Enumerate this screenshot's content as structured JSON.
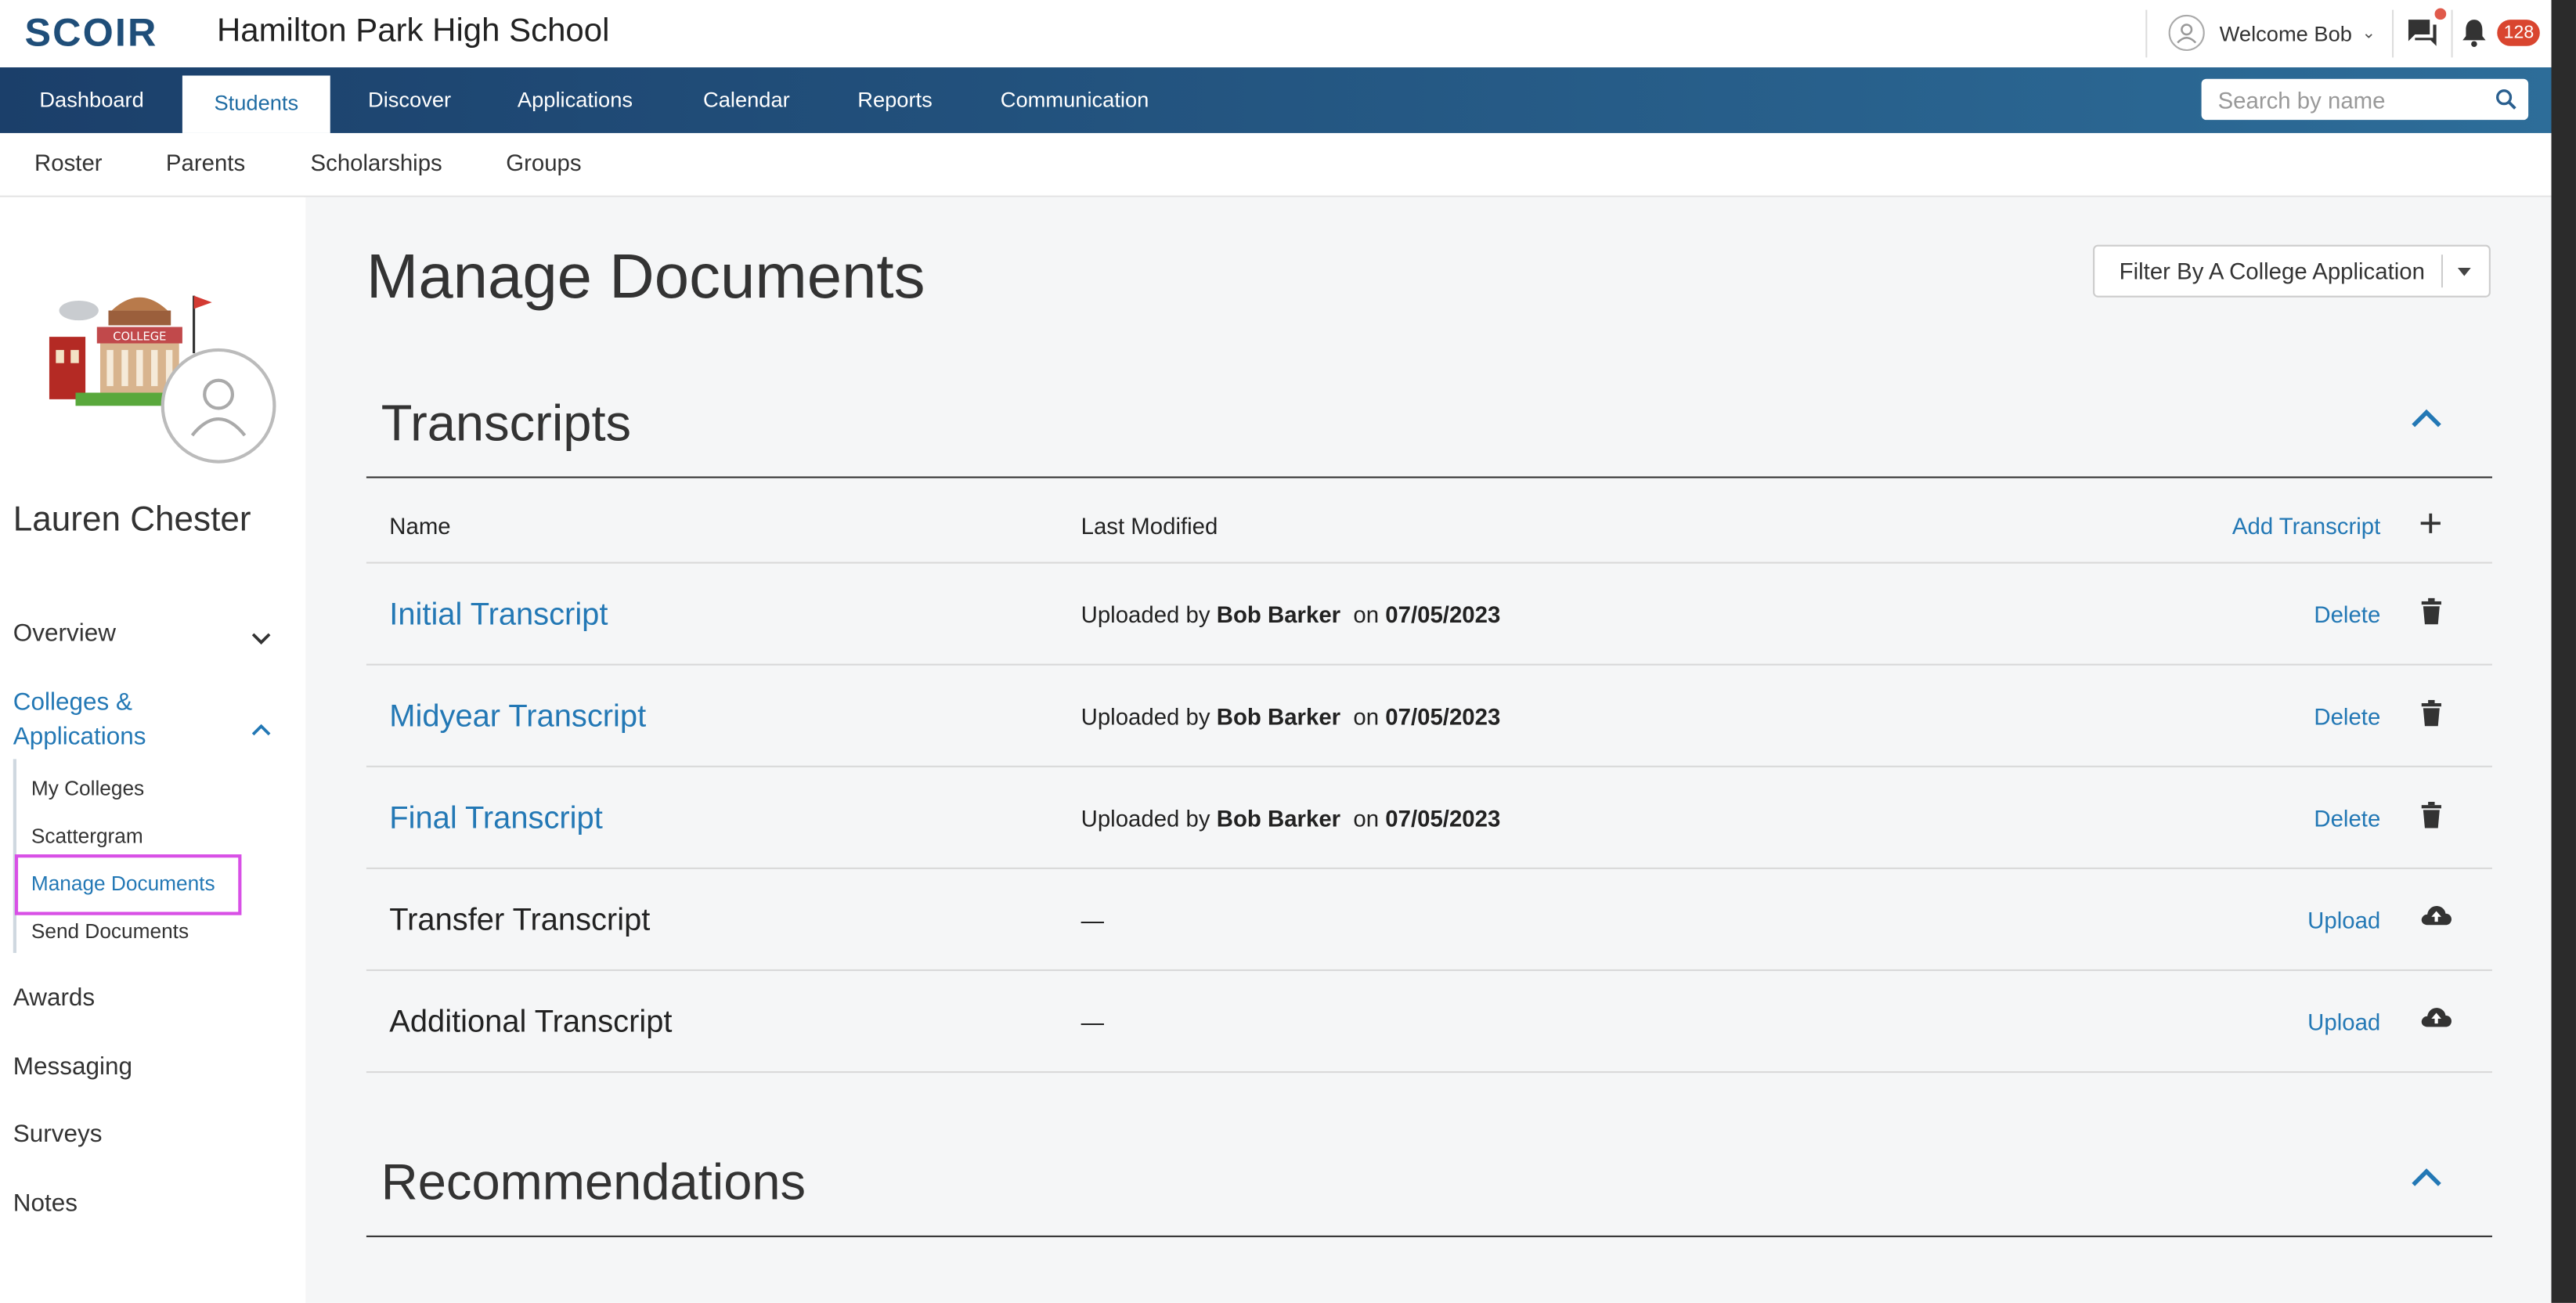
{
  "brand": {
    "logo": "SCOIR",
    "school": "Hamilton Park High School"
  },
  "header": {
    "welcome": "Welcome Bob",
    "notification_count": "128"
  },
  "nav": {
    "tabs": [
      "Dashboard",
      "Students",
      "Discover",
      "Applications",
      "Calendar",
      "Reports",
      "Communication"
    ],
    "active": "Students"
  },
  "search": {
    "placeholder": "Search by name"
  },
  "subnav": [
    "Roster",
    "Parents",
    "Scholarships",
    "Groups"
  ],
  "sidebar": {
    "student_name": "Lauren Chester",
    "overview": "Overview",
    "colleges_line1": "Colleges &",
    "colleges_line2": "Applications",
    "sub_items": [
      "My Colleges",
      "Scattergram",
      "Manage Documents",
      "Send Documents"
    ],
    "items": [
      "Awards",
      "Messaging",
      "Surveys",
      "Notes"
    ]
  },
  "main": {
    "title": "Manage Documents",
    "filter_label": "Filter By A College Application",
    "transcripts": {
      "title": "Transcripts",
      "col_name": "Name",
      "col_modified": "Last Modified",
      "add_label": "Add Transcript",
      "rows": [
        {
          "name": "Initial Transcript",
          "prefix": "Uploaded by",
          "by": "Bob Barker",
          "on": "on",
          "date": "07/05/2023",
          "action": "Delete"
        },
        {
          "name": "Midyear Transcript",
          "prefix": "Uploaded by",
          "by": "Bob Barker",
          "on": "on",
          "date": "07/05/2023",
          "action": "Delete"
        },
        {
          "name": "Final Transcript",
          "prefix": "Uploaded by",
          "by": "Bob Barker",
          "on": "on",
          "date": "07/05/2023",
          "action": "Delete"
        },
        {
          "name": "Transfer Transcript",
          "dash": "—",
          "action": "Upload"
        },
        {
          "name": "Additional Transcript",
          "dash": "—",
          "action": "Upload"
        }
      ]
    },
    "recommendations": {
      "title": "Recommendations"
    }
  },
  "colors": {
    "nav_start": "#1b3f6a",
    "nav_end": "#2d6d99",
    "link": "#2378b5",
    "badge": "#d9452f",
    "highlight": "#d850e6"
  },
  "icons": [
    "user-icon",
    "chat-icon",
    "bell-icon",
    "search-icon",
    "chevron-down-icon",
    "chevron-up-icon",
    "plus-icon",
    "trash-icon",
    "cloud-upload-icon"
  ]
}
